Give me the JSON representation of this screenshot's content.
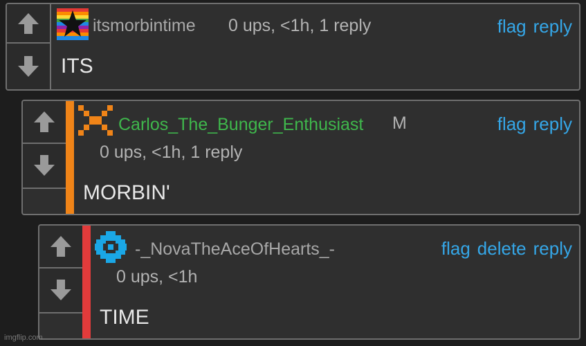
{
  "colors": {
    "link": "#35a7e8",
    "comment2_accent": "#f08418",
    "comment3_accent": "#e23b3b",
    "comment2_username": "#3fb74c"
  },
  "comments": [
    {
      "username": "itsmorbintime",
      "meta": "0 ups, <1h, 1 reply",
      "actions": [
        "flag",
        "reply"
      ],
      "text": "ITS",
      "avatar_icon": "rainbow-star-icon"
    },
    {
      "username": "Carlos_The_Bunger_Enthusiast",
      "badge": "M",
      "meta": "0 ups, <1h, 1 reply",
      "actions": [
        "flag",
        "reply"
      ],
      "text": "MORBIN'",
      "avatar_icon": "orange-x-icon"
    },
    {
      "username": "-_NovaTheAceOfHearts_-",
      "meta": "0 ups, <1h",
      "actions": [
        "flag",
        "delete",
        "reply"
      ],
      "text": "TIME",
      "avatar_icon": "blue-diamond-icon"
    }
  ],
  "watermark": "imgflip.com"
}
